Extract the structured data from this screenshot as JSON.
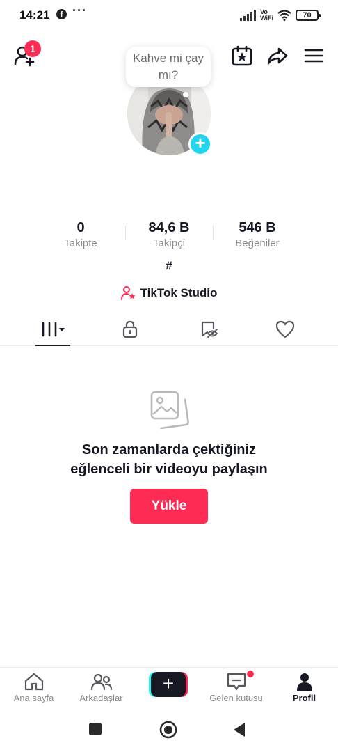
{
  "status_bar": {
    "time": "14:21",
    "app_icon": "facebook-icon",
    "more": "···",
    "network_label_top": "Vo",
    "network_label_bottom": "WiFi",
    "battery": "70"
  },
  "header": {
    "notification_count": "1",
    "icons": [
      "add-friend-icon",
      "calendar-star-icon",
      "share-arrow-icon",
      "menu-icon"
    ]
  },
  "profile": {
    "note_bubble": "Kahve mi çay mı?",
    "stats": [
      {
        "value": "0",
        "label": "Takipte"
      },
      {
        "value": "84,6 B",
        "label": "Takipçi"
      },
      {
        "value": "546 B",
        "label": "Beğeniler"
      }
    ],
    "bio": "#",
    "studio_label": "TikTok Studio"
  },
  "tabs": [
    {
      "name": "videos",
      "icon": "grid-bars-icon",
      "active": true
    },
    {
      "name": "private",
      "icon": "lock-icon",
      "active": false
    },
    {
      "name": "reposts",
      "icon": "repost-eye-icon",
      "active": false
    },
    {
      "name": "liked",
      "icon": "heart-icon",
      "active": false
    }
  ],
  "empty_state": {
    "icon": "photo-stack-icon",
    "title_line1": "Son zamanlarda çektiğiniz",
    "title_line2": "eğlenceli bir videoyu paylaşın",
    "button": "Yükle"
  },
  "bottom_nav": {
    "home": "Ana sayfa",
    "friends": "Arkadaşlar",
    "inbox": "Gelen kutusu",
    "profile": "Profil"
  },
  "colors": {
    "accent": "#fe2c55",
    "cyan": "#25f4ee",
    "text": "#161823",
    "muted": "#8a8b91"
  }
}
